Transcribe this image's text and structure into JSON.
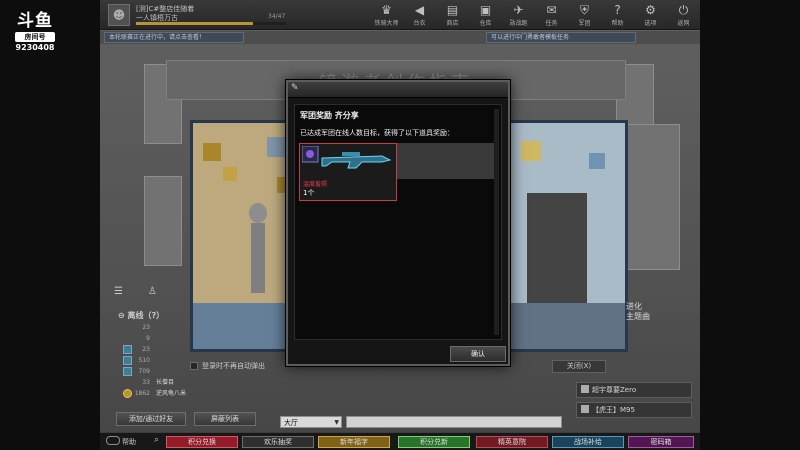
{
  "stream": {
    "logo_text": "斗鱼",
    "room_label": "房间号",
    "room_number": "9230408"
  },
  "player": {
    "name": "[测]C#整店佳随着",
    "title": "一人镇梧万古",
    "level_text": "34/47",
    "exp_fraction": 0.78
  },
  "nav": [
    {
      "label": "铁骑大师",
      "icon": "trophy-icon",
      "glyph": "♛"
    },
    {
      "label": "台衣",
      "icon": "speaker-icon",
      "glyph": "◀"
    },
    {
      "label": "商店",
      "icon": "shop-icon",
      "glyph": "▤"
    },
    {
      "label": "仓库",
      "icon": "box-icon",
      "glyph": "▣"
    },
    {
      "label": "勋战跑",
      "icon": "vehicle-icon",
      "glyph": "✈"
    },
    {
      "label": "任务",
      "icon": "mail-icon",
      "glyph": "✉"
    },
    {
      "label": "军团",
      "icon": "shield-icon",
      "glyph": "⛨"
    },
    {
      "label": "帮助",
      "icon": "help-icon",
      "glyph": "?"
    },
    {
      "label": "选项",
      "icon": "gear-icon",
      "glyph": "⚙"
    },
    {
      "label": "返网",
      "icon": "power-icon",
      "glyph": "⏻"
    }
  ],
  "notices": {
    "left": "本轮联赛正在进行中，请点击查看！",
    "right": "可以进行中门勇敢者模板任务"
  },
  "bg_title": "镜游者创作指南",
  "chat": {
    "tab_icons": [
      "list-icon",
      "friends-icon"
    ],
    "friends_header": "离线（?）"
  },
  "friends": [
    {
      "num": "23",
      "name": "",
      "avatar": ""
    },
    {
      "num": "9",
      "name": "",
      "avatar": ""
    },
    {
      "num": "23",
      "name": "",
      "avatar": "plain"
    },
    {
      "num": "510",
      "name": "",
      "avatar": "plain"
    },
    {
      "num": "709",
      "name": "",
      "avatar": "plain"
    },
    {
      "num": "33",
      "name": "长僧目",
      "avatar": ""
    },
    {
      "num": "1862",
      "name": "逆风龟八米",
      "avatar": "gold"
    }
  ],
  "auto_popup_label": "登录时不再自动弹出",
  "buttons": {
    "add_friend": "添加/通过好友",
    "block_list": "屏蔽列表",
    "close": "关闭(X)"
  },
  "channel": {
    "selected": "大厅"
  },
  "right_side": {
    "partial_text_1": "进化",
    "partial_text_2": "主题曲"
  },
  "rooms": [
    "超宇尊要Zero",
    "【虎王】M95"
  ],
  "taskbar": {
    "help_label": "帮助",
    "buttons": [
      "积分兑换",
      "欢乐抽奖",
      "新年福字",
      "积分兑新",
      "精英意院",
      "战场补给",
      "密码箱"
    ]
  },
  "dialog": {
    "title": "军团奖励 齐分享",
    "message": "已达成军团在线人数目标，获得了以下道具奖励：",
    "item": {
      "name": "温度羞照",
      "qty": "1个"
    },
    "confirm": "确认"
  }
}
